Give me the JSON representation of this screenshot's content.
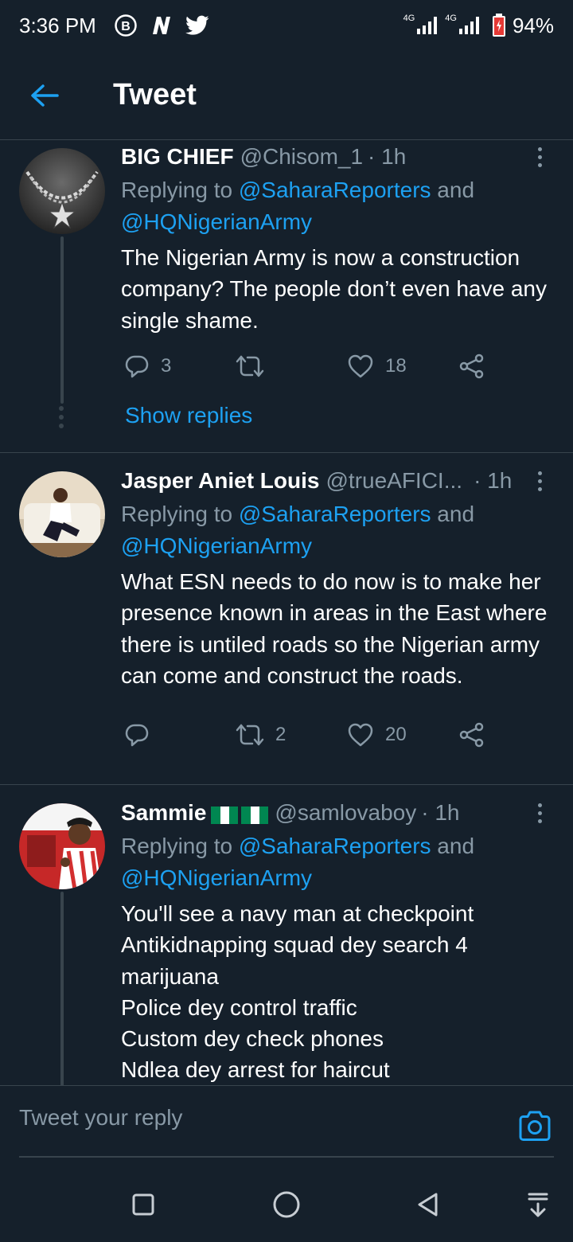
{
  "status_bar": {
    "time": "3:36 PM",
    "left_icons": [
      "b-circle-icon",
      "n-logo-icon",
      "twitter-bird-icon"
    ],
    "network_1": "4G",
    "network_2": "4G",
    "battery": "94%"
  },
  "header": {
    "back_icon": "arrow-left-icon",
    "title": "Tweet"
  },
  "colors": {
    "background": "#15202b",
    "accent": "#1da1f2",
    "secondary_text": "#8899a6",
    "divider": "#38444d"
  },
  "tweets": [
    {
      "name": "BIG CHIEF",
      "handle": "@Chisom_1",
      "time": "· 1h",
      "reply_prefix": "Replying to ",
      "reply_mention_1": "@SaharaReporters",
      "reply_and": " and",
      "reply_mention_2": "@HQNigerianArmy",
      "text": "The Nigerian Army is now a construction company? The people don’t even have any single shame.",
      "replies": "3",
      "retweets": "",
      "likes": "18",
      "show_replies": "Show replies"
    },
    {
      "name": "Jasper Aniet Louis",
      "handle": "@trueAFICI...",
      "time": "· 1h",
      "reply_prefix": "Replying to ",
      "reply_mention_1": "@SaharaReporters",
      "reply_and": " and",
      "reply_mention_2": "@HQNigerianArmy",
      "text": "What ESN needs to do now is to make her presence known in areas in the East where there is untiled roads so the Nigerian army can come and construct the roads.",
      "replies": "",
      "retweets": "2",
      "likes": "20"
    },
    {
      "name": "Sammie",
      "handle": "@samlovaboy",
      "time": "· 1h",
      "reply_prefix": "Replying to ",
      "reply_mention_1": "@SaharaReporters",
      "reply_and": " and",
      "reply_mention_2": "@HQNigerianArmy",
      "text": "You'll see a navy man at checkpoint\nAntikidnapping squad dey search 4 marijuana\nPolice dey control traffic\nCustom dey check phones\nNdlea dey arrest for haircut"
    }
  ],
  "compose": {
    "placeholder": "Tweet your reply"
  },
  "nav": {
    "icons": [
      "square-icon",
      "circle-icon",
      "triangle-back-icon",
      "notification-down-icon"
    ]
  }
}
